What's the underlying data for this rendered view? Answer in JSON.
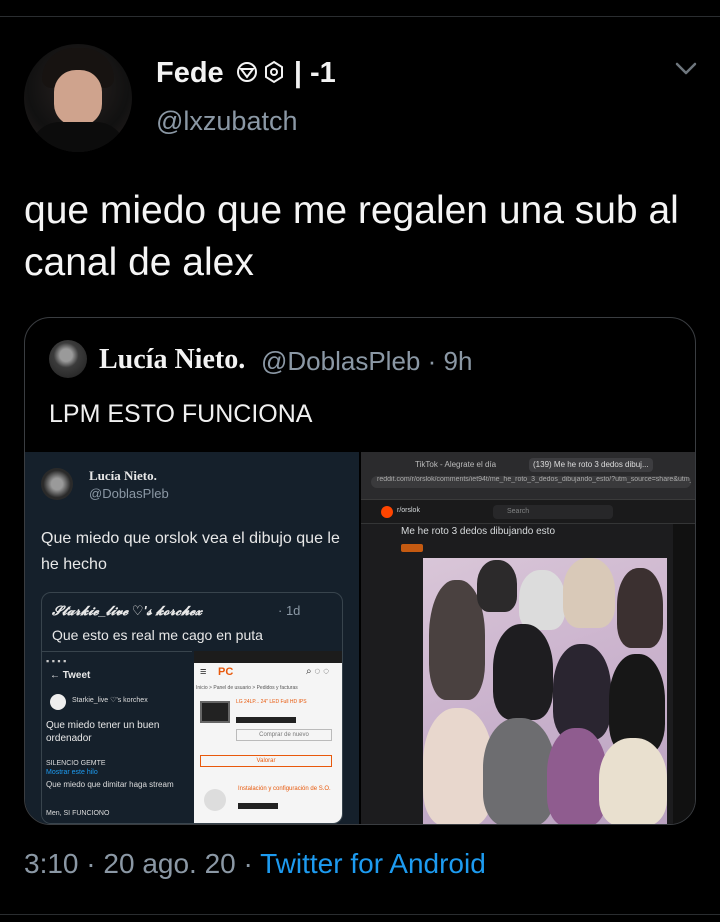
{
  "tweet": {
    "display_name": "Fede",
    "name_suffix": "| -1",
    "handle": "@lxzubatch",
    "text": "que miedo que me regalen una sub al canal de alex",
    "time": "3:10",
    "date": "20 ago. 20",
    "source": "Twitter for Android"
  },
  "quote": {
    "display_name": "Lucía Nieto.",
    "handle": "@DoblasPleb",
    "age": "9h",
    "text": "LPM ESTO FUNCIONA"
  },
  "image_left": {
    "name": "Lucía Nieto.",
    "handle": "@DoblasPleb",
    "text": "Que miedo que orslok vea el dibujo que le he hecho",
    "inner_quote_name": "𝓢𝓽𝓪𝓻𝓴𝓲𝓮_𝓵𝓲𝓿𝓮 ♡'𝓼 𝓴𝓸𝓻𝓬𝓱𝓮𝔁",
    "inner_quote_age": "· 1d",
    "inner_quote_text": "Que esto es real me cago en puta",
    "phone_left": {
      "header": "Tweet",
      "text1": "Que miedo tener un buen",
      "text2": "ordenador",
      "line1": "SILENCIO GEMTE",
      "line2": "Mostrar este hilo",
      "line3": "Que miedo que dimitar haga stream",
      "line4": "Men, SI FUNCIONO"
    },
    "phone_right": {
      "logo": "PC",
      "breadcrumb": "Inicio > Panel de usuario > Pedidos y facturas",
      "product": "LG 24LP... 24\" LED Full HD IPS",
      "btn1": "Comprar de nuevo",
      "btn2": "Valorar",
      "item2": "Instalación y configuración de S.O."
    }
  },
  "image_right": {
    "tab1": "TikTok - Alegrate el día",
    "tab2": "(139) Me he roto 3 dedos dibuj...",
    "url": "reddit.com/r/orslok/comments/iet94t/me_he_roto_3_dedos_dibujando_esto/?utm_source=share&utm_medium=ios_app",
    "subreddit": "r/orslok",
    "search": "Search",
    "post_title": "Me he roto 3 dedos dibujando esto"
  }
}
